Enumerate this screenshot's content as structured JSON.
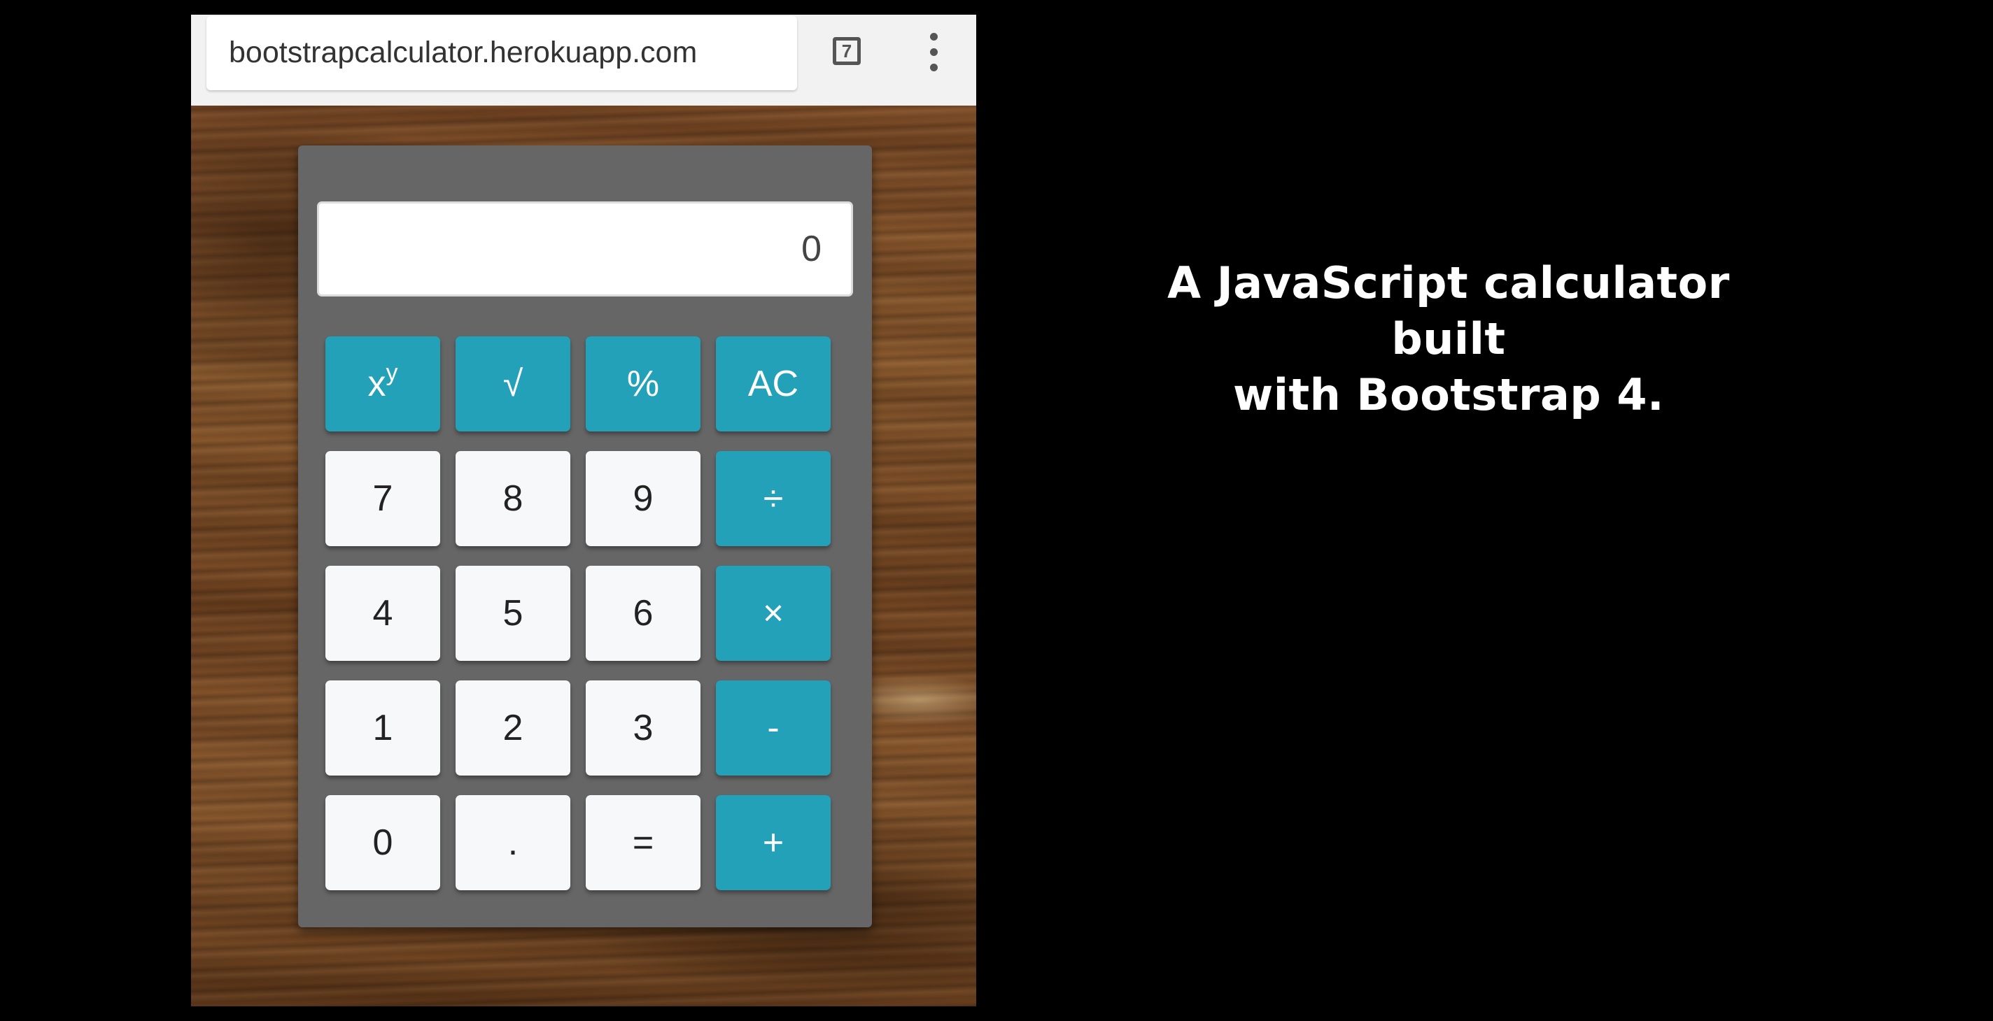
{
  "browser": {
    "url": "bootstrapcalculator.herokuapp.com",
    "tab_count": "7",
    "menu_icon": "more-vert-icon",
    "tabs_icon": "tab-switcher-icon"
  },
  "calculator": {
    "display_value": "0",
    "keys": {
      "pow_base": "x",
      "pow_exp": "y",
      "sqrt": "√",
      "percent": "%",
      "clear": "AC",
      "n7": "7",
      "n8": "8",
      "n9": "9",
      "divide": "÷",
      "n4": "4",
      "n5": "5",
      "n6": "6",
      "multiply": "×",
      "n1": "1",
      "n2": "2",
      "n3": "3",
      "minus": "-",
      "n0": "0",
      "decimal": ".",
      "equals": "=",
      "plus": "+"
    },
    "colors": {
      "operator_key": "#22a1b8",
      "number_key": "#f7f8fa",
      "body": "#666666"
    }
  },
  "caption": {
    "line1": "A JavaScript calculator built",
    "line2": "with Bootstrap 4."
  }
}
